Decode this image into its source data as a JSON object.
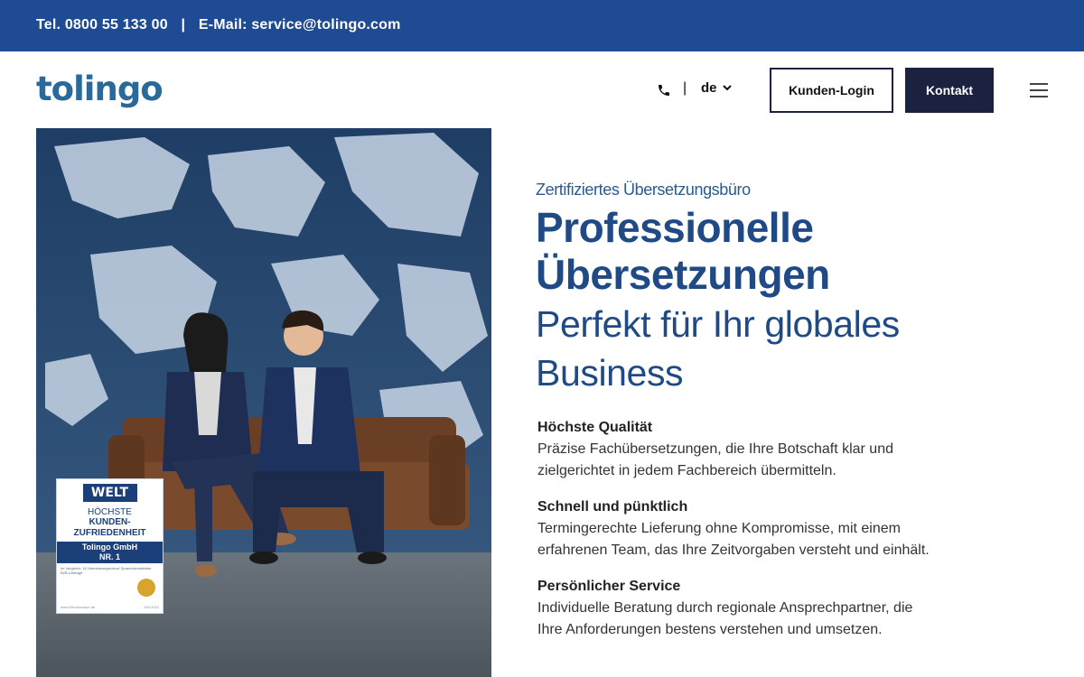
{
  "topbar": {
    "phone": "Tel. 0800 55 133 00",
    "separator": "|",
    "email": "E-Mail: service@tolingo.com"
  },
  "header": {
    "logo": "tolingo",
    "phone_icon": "phone-icon",
    "lang_separator": "|",
    "language": "de",
    "login_button": "Kunden-Login",
    "contact_button": "Kontakt",
    "menu_icon": "hamburger-menu-icon"
  },
  "badge": {
    "brand": "WELT",
    "line1": "HÖCHSTE",
    "line2": "KUNDEN-",
    "line3": "ZUFRIEDENHEIT",
    "company": "Tolingo GmbH",
    "rank": "NR. 1",
    "fineprint": "Im Vergleich: 16 Übersetzungsbüros/ Sprachdienstleister B2B-Umfrage",
    "footer_left": "www.Servicevalue.de",
    "footer_right": "KW 2022"
  },
  "hero": {
    "eyebrow": "Zertifiziertes Übersetzungsbüro",
    "title_line1": "Professionelle",
    "title_line2": "Übersetzungen",
    "subtitle_line1": "Perfekt für Ihr globales",
    "subtitle_line2": "Business",
    "features": [
      {
        "heading": "Höchste Qualität",
        "text_line1": "Präzise Fachübersetzungen, die Ihre Botschaft klar und",
        "text_line2": "zielgerichtet in jedem Fachbereich übermitteln."
      },
      {
        "heading": "Schnell und pünktlich",
        "text_line1": "Termingerechte Lieferung ohne Kompromisse, mit einem",
        "text_line2": "erfahrenen Team, das Ihre Zeitvorgaben versteht und einhält."
      },
      {
        "heading": "Persönlicher Service",
        "text_line1": "Individuelle Beratung durch regionale Ansprechpartner, die",
        "text_line2": "Ihre Anforderungen bestens verstehen und umsetzen."
      }
    ]
  },
  "colors": {
    "topbar": "#1f4b95",
    "navy": "#1a2240",
    "heading_blue": "#1f4a85"
  }
}
